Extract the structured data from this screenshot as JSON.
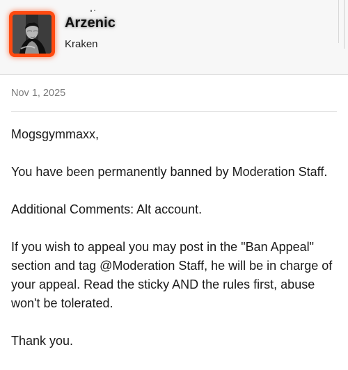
{
  "author": {
    "username": "Arzenic",
    "user_title": "Kraken",
    "avatar_accent_color": "#ff4a10"
  },
  "message": {
    "date": "Nov 1, 2025",
    "greeting": "Mogsgymmaxx,",
    "line_ban": "You have been permanently banned by Moderation Staff.",
    "line_comments": "Additional Comments: Alt account.",
    "line_appeal": "If you wish to appeal you may post in the \"Ban Appeal\" section and tag @Moderation Staff, he will be in charge of your appeal. Read the sticky AND the rules first, abuse won't be tolerated.",
    "closing": "Thank you."
  }
}
